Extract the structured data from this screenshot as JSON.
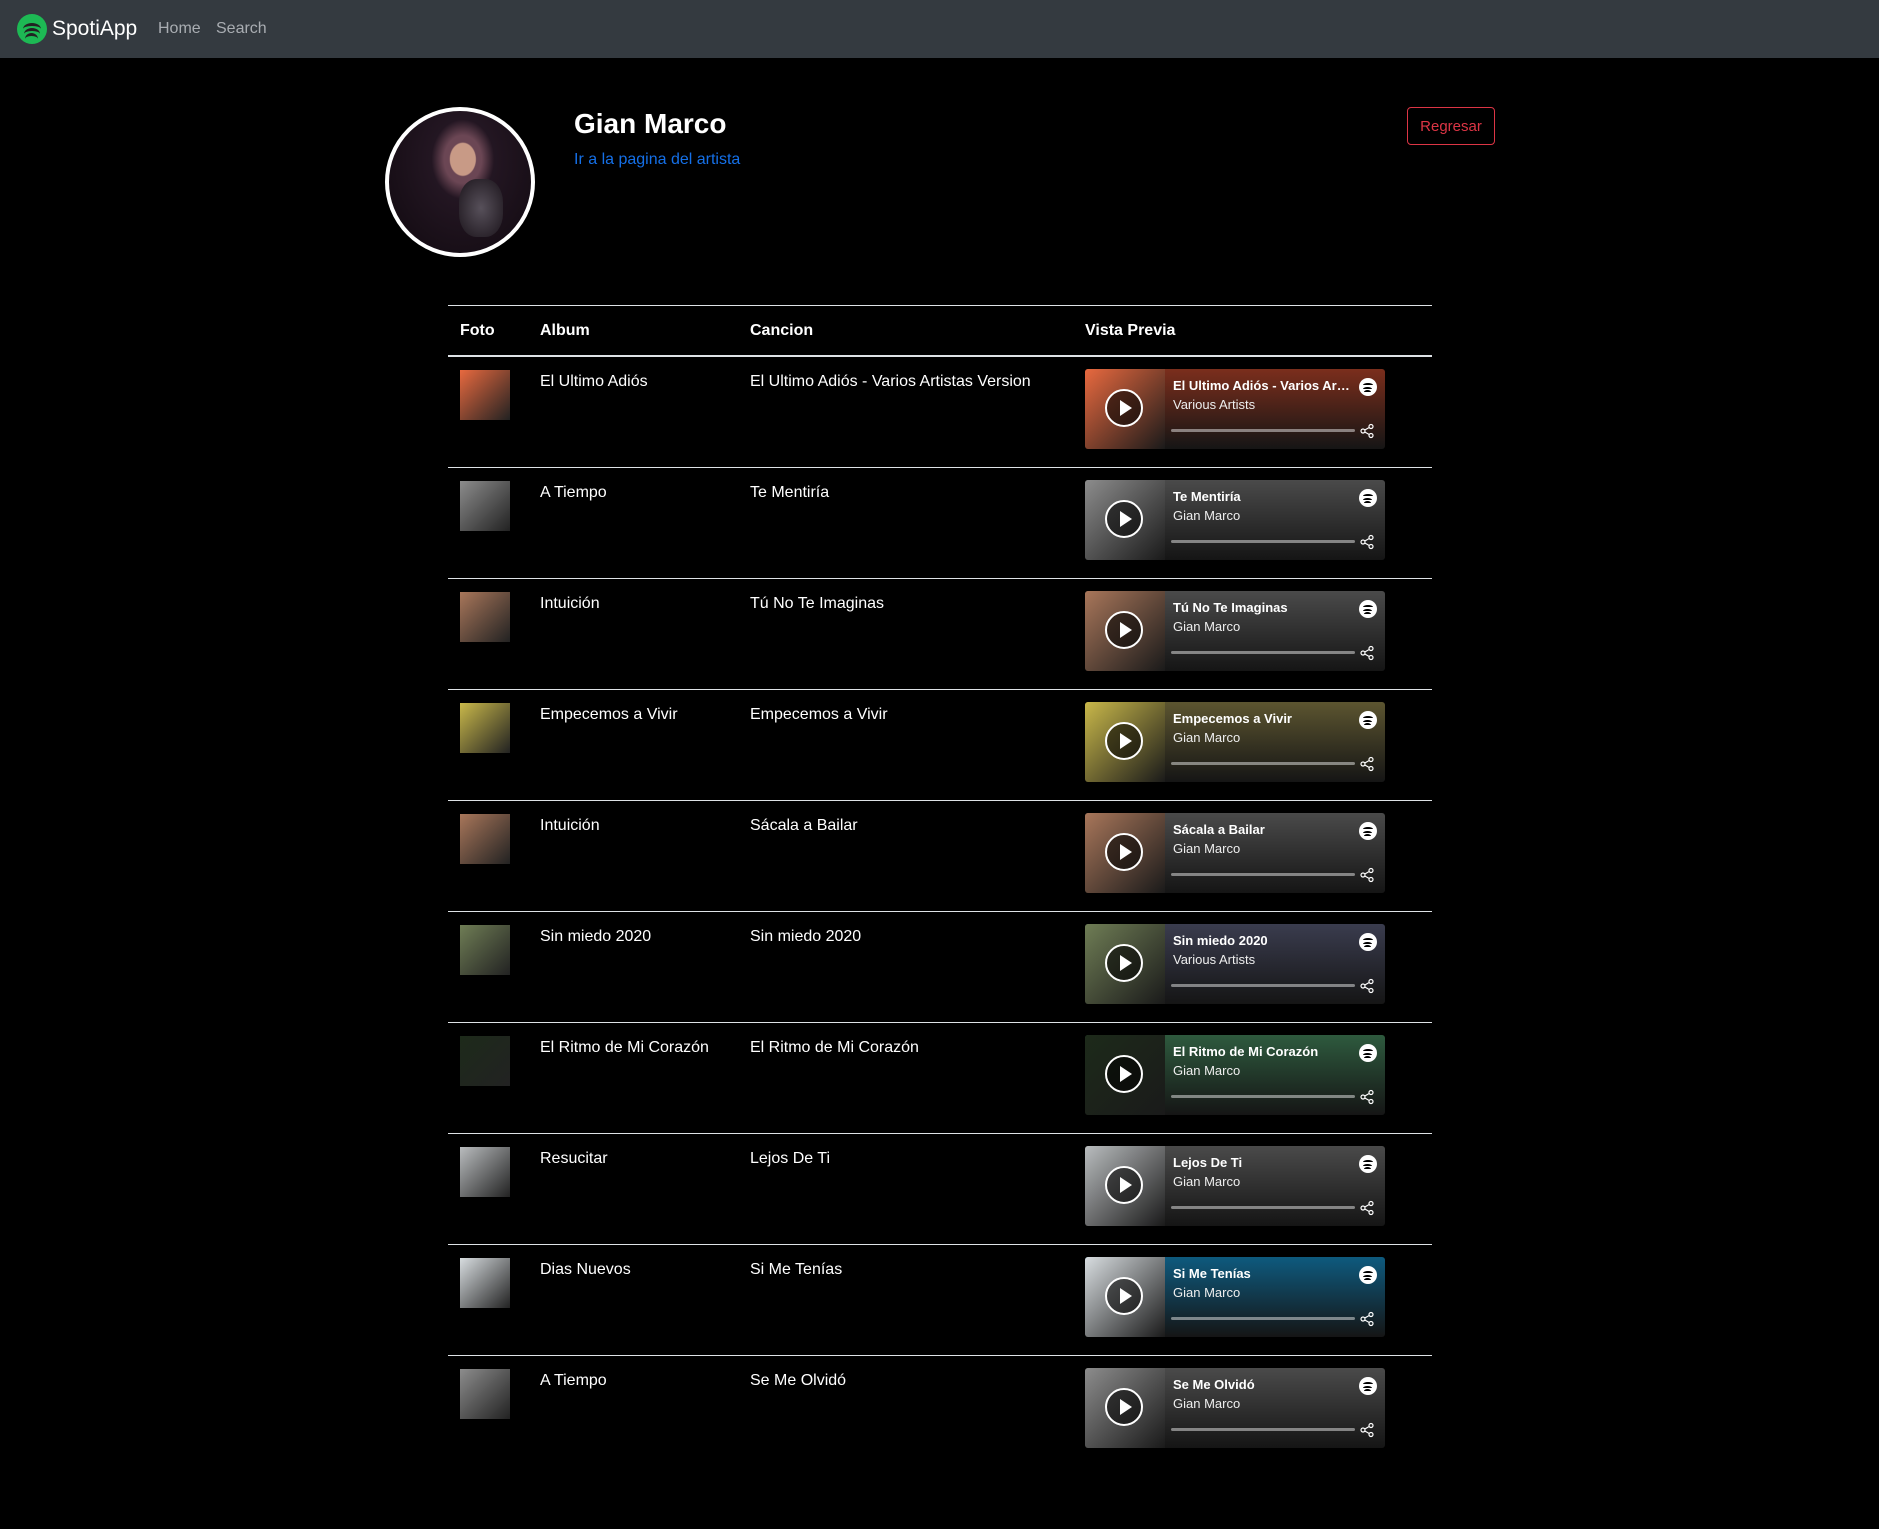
{
  "navbar": {
    "brand": "SpotiApp",
    "links": [
      "Home",
      "Search"
    ]
  },
  "artist": {
    "name": "Gian Marco",
    "link_text": "Ir a la pagina del artista",
    "back_button": "Regresar"
  },
  "table": {
    "headers": [
      "Foto",
      "Album",
      "Cancion",
      "Vista Previa"
    ],
    "rows": [
      {
        "album": "El Ultimo Adiós",
        "song": "El Ultimo Adiós - Varios Artistas Version",
        "embed_title": "El Ultimo Adiós - Varios Artistas Version",
        "embed_artist": "Various Artists",
        "art_color": "#e8693f",
        "embed_color": "#7b2e1c"
      },
      {
        "album": "A Tiempo",
        "song": "Te Mentiría",
        "embed_title": "Te Mentiría",
        "embed_artist": "Gian Marco",
        "art_color": "#8c8c8c",
        "embed_color": "#4a4a4a"
      },
      {
        "album": "Intuición",
        "song": "Tú No Te Imaginas",
        "embed_title": "Tú No Te Imaginas",
        "embed_artist": "Gian Marco",
        "art_color": "#a8765a",
        "embed_color": "#4a4a4a"
      },
      {
        "album": "Empecemos a Vivir",
        "song": "Empecemos a Vivir",
        "embed_title": "Empecemos a Vivir",
        "embed_artist": "Gian Marco",
        "art_color": "#c9b84a",
        "embed_color": "#5c5530"
      },
      {
        "album": "Intuición",
        "song": "Sácala a Bailar",
        "embed_title": "Sácala a Bailar",
        "embed_artist": "Gian Marco",
        "art_color": "#a8765a",
        "embed_color": "#4a4a4a"
      },
      {
        "album": "Sin miedo 2020",
        "song": "Sin miedo 2020",
        "embed_title": "Sin miedo 2020",
        "embed_artist": "Various Artists",
        "art_color": "#6f7d55",
        "embed_color": "#3a3c4e"
      },
      {
        "album": "El Ritmo de Mi Corazón",
        "song": "El Ritmo de Mi Corazón",
        "embed_title": "El Ritmo de Mi Corazón",
        "embed_artist": "Gian Marco",
        "art_color": "#1d2a1a",
        "embed_color": "#2e5a3e"
      },
      {
        "album": "Resucitar",
        "song": "Lejos De Ti",
        "embed_title": "Lejos De Ti",
        "embed_artist": "Gian Marco",
        "art_color": "#b9bcbe",
        "embed_color": "#4a4a4a"
      },
      {
        "album": "Dias Nuevos",
        "song": "Si Me Tenías",
        "embed_title": "Si Me Tenías",
        "embed_artist": "Gian Marco",
        "art_color": "#d8dde0",
        "embed_color": "#0e5a7e"
      },
      {
        "album": "A Tiempo",
        "song": "Se Me Olvidó",
        "embed_title": "Se Me Olvidó",
        "embed_artist": "Gian Marco",
        "art_color": "#8c8c8c",
        "embed_color": "#4a4a4a"
      }
    ]
  }
}
